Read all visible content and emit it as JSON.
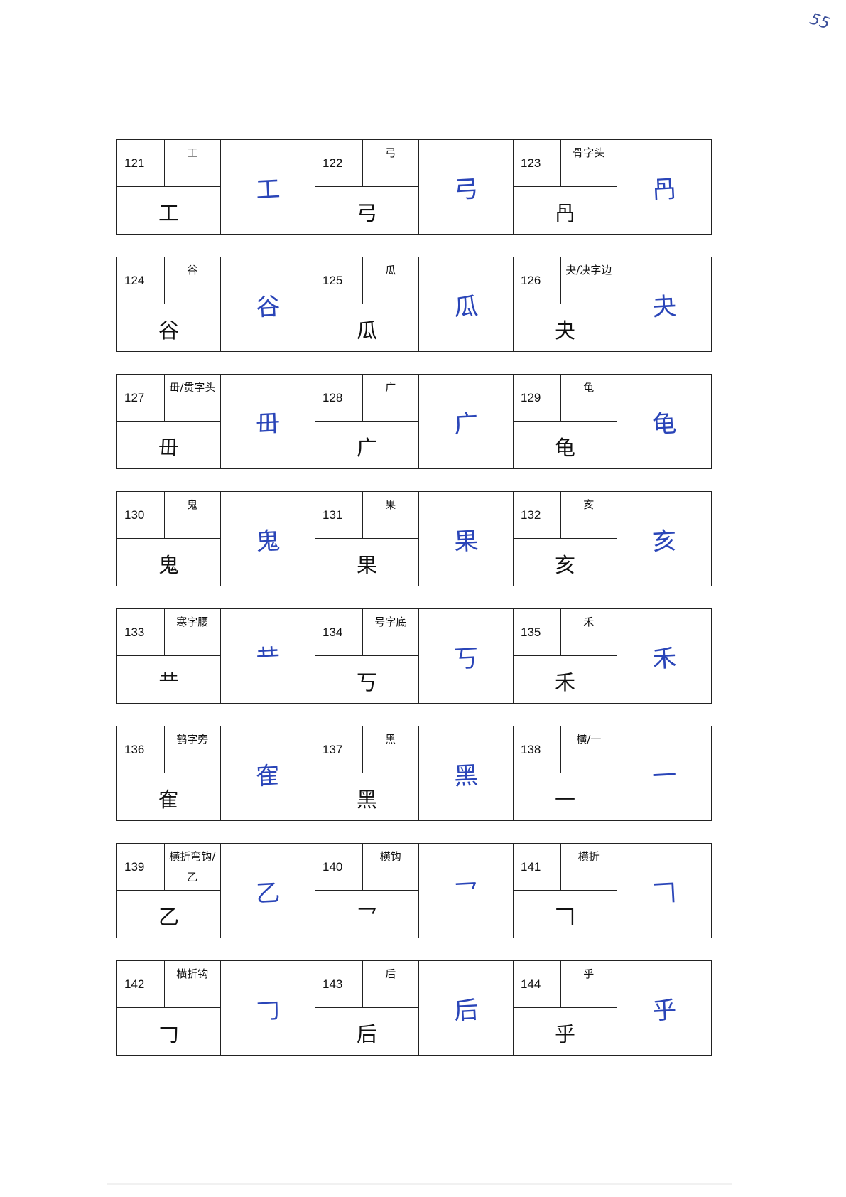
{
  "page_number": "55",
  "rows": [
    [
      {
        "num": "121",
        "name": "工",
        "glyph": "工",
        "hand": "工"
      },
      {
        "num": "122",
        "name": "弓",
        "glyph": "弓",
        "hand": "弓"
      },
      {
        "num": "123",
        "name": "骨字头",
        "glyph": "冎",
        "hand": "冎"
      }
    ],
    [
      {
        "num": "124",
        "name": "谷",
        "glyph": "谷",
        "hand": "谷"
      },
      {
        "num": "125",
        "name": "瓜",
        "glyph": "瓜",
        "hand": "瓜"
      },
      {
        "num": "126",
        "name": "夬/决字边",
        "glyph": "夬",
        "hand": "夬"
      }
    ],
    [
      {
        "num": "127",
        "name": "毌/贯字头",
        "glyph": "毌",
        "hand": "毌"
      },
      {
        "num": "128",
        "name": "广",
        "glyph": "广",
        "hand": "广"
      },
      {
        "num": "129",
        "name": "龟",
        "glyph": "龟",
        "hand": "龟"
      }
    ],
    [
      {
        "num": "130",
        "name": "鬼",
        "glyph": "鬼",
        "hand": "鬼"
      },
      {
        "num": "131",
        "name": "果",
        "glyph": "果",
        "hand": "果"
      },
      {
        "num": "132",
        "name": "亥",
        "glyph": "亥",
        "hand": "亥"
      }
    ],
    [
      {
        "num": "133",
        "name": "寒字腰",
        "glyph": "龷",
        "hand": "龷"
      },
      {
        "num": "134",
        "name": "号字底",
        "glyph": "丂",
        "hand": "丂"
      },
      {
        "num": "135",
        "name": "禾",
        "glyph": "禾",
        "hand": "禾"
      }
    ],
    [
      {
        "num": "136",
        "name": "鹤字旁",
        "glyph": "隺",
        "hand": "隺"
      },
      {
        "num": "137",
        "name": "黑",
        "glyph": "黑",
        "hand": "黑"
      },
      {
        "num": "138",
        "name": "横/一",
        "glyph": "一",
        "hand": "一"
      }
    ],
    [
      {
        "num": "139",
        "name": "横折弯钩/乙",
        "glyph": "乙",
        "hand": "乙"
      },
      {
        "num": "140",
        "name": "横钩",
        "glyph": "乛",
        "hand": "乛"
      },
      {
        "num": "141",
        "name": "横折",
        "glyph": "𠃍",
        "hand": "𠃍"
      }
    ],
    [
      {
        "num": "142",
        "name": "横折钩",
        "glyph": "𠃌",
        "hand": "𠃌"
      },
      {
        "num": "143",
        "name": "后",
        "glyph": "后",
        "hand": "后"
      },
      {
        "num": "144",
        "name": "乎",
        "glyph": "乎",
        "hand": "乎"
      }
    ]
  ]
}
